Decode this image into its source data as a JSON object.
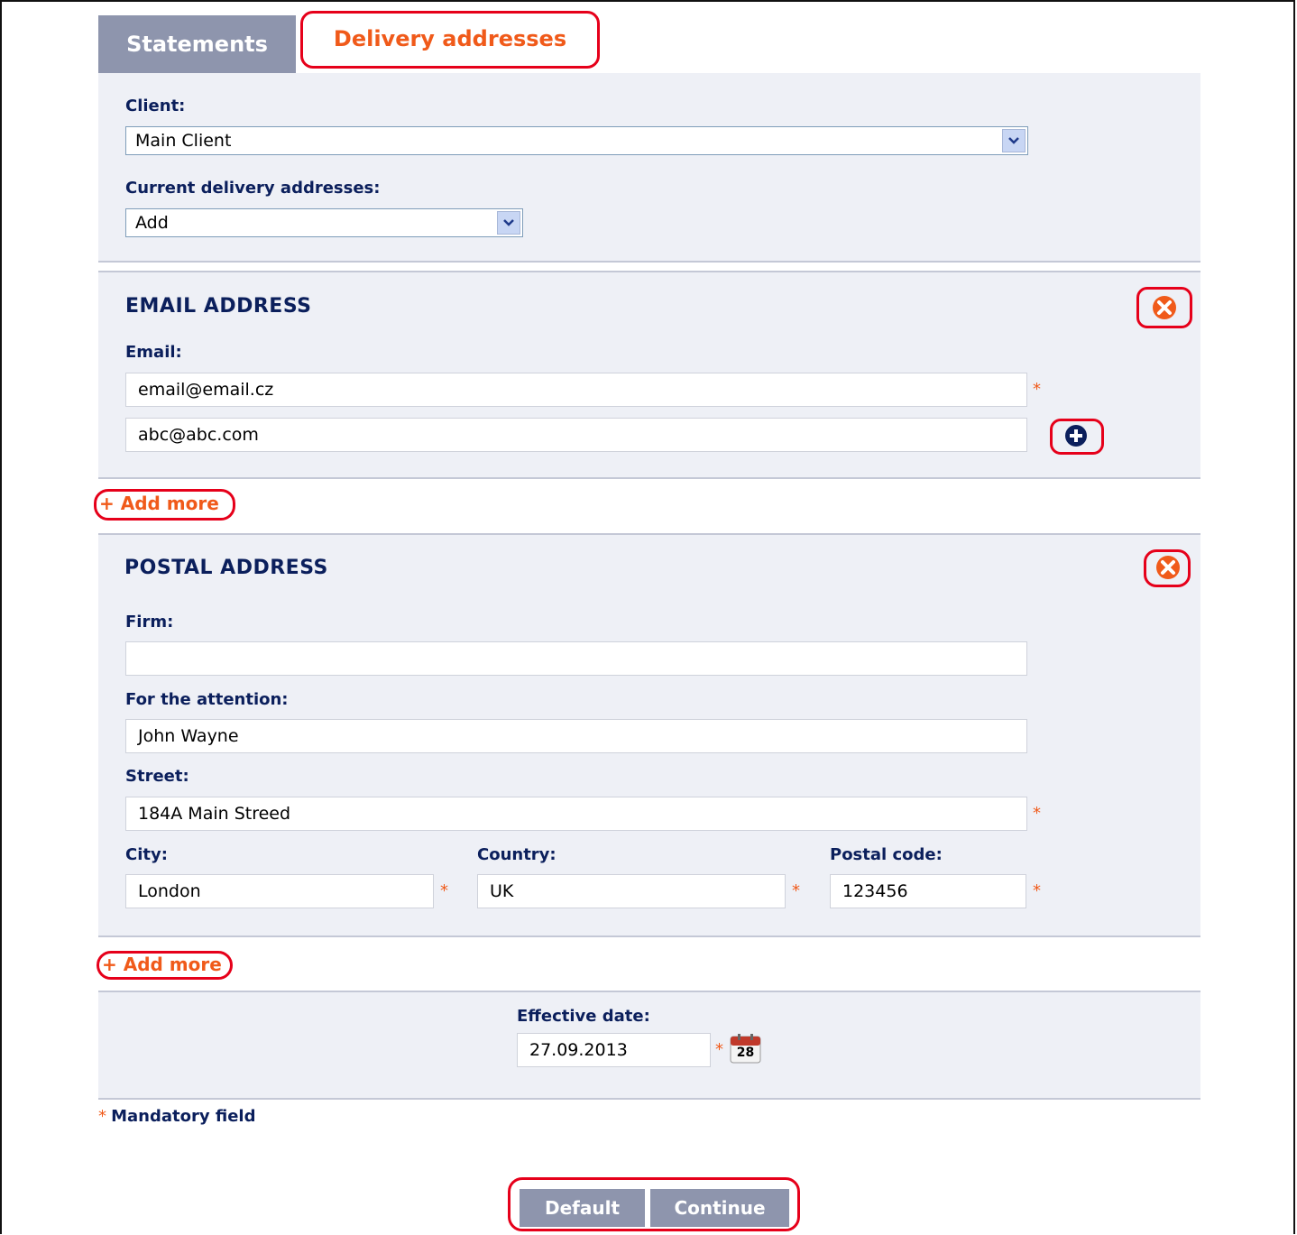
{
  "tabs": {
    "statements": "Statements",
    "delivery": "Delivery addresses"
  },
  "client": {
    "label": "Client:",
    "value": "Main Client"
  },
  "current": {
    "label": "Current delivery addresses:",
    "value": "Add"
  },
  "email_section": {
    "title": "EMAIL ADDRESS",
    "label": "Email:",
    "values": [
      "email@email.cz",
      "abc@abc.com"
    ],
    "add_more": "+ Add more"
  },
  "postal_section": {
    "title": "POSTAL ADDRESS",
    "firm_label": "Firm:",
    "firm_value": "",
    "attention_label": "For the attention:",
    "attention_value": "John Wayne",
    "street_label": "Street:",
    "street_value": "184A Main Streed",
    "city_label": "City:",
    "city_value": "London",
    "country_label": "Country:",
    "country_value": "UK",
    "postal_label": "Postal code:",
    "postal_value": "123456",
    "add_more": "+ Add more"
  },
  "effective": {
    "label": "Effective date:",
    "value": "27.09.2013",
    "calendar_day": "28"
  },
  "mandatory_star": "*",
  "mandatory_note": "Mandatory field",
  "buttons": {
    "default": "Default",
    "continue": "Continue"
  },
  "colors": {
    "accent": "#f05a1a",
    "navy": "#0b1f5c",
    "panel": "#eef0f6",
    "tab_gray": "#8e95ad",
    "highlight": "#e6001a"
  }
}
